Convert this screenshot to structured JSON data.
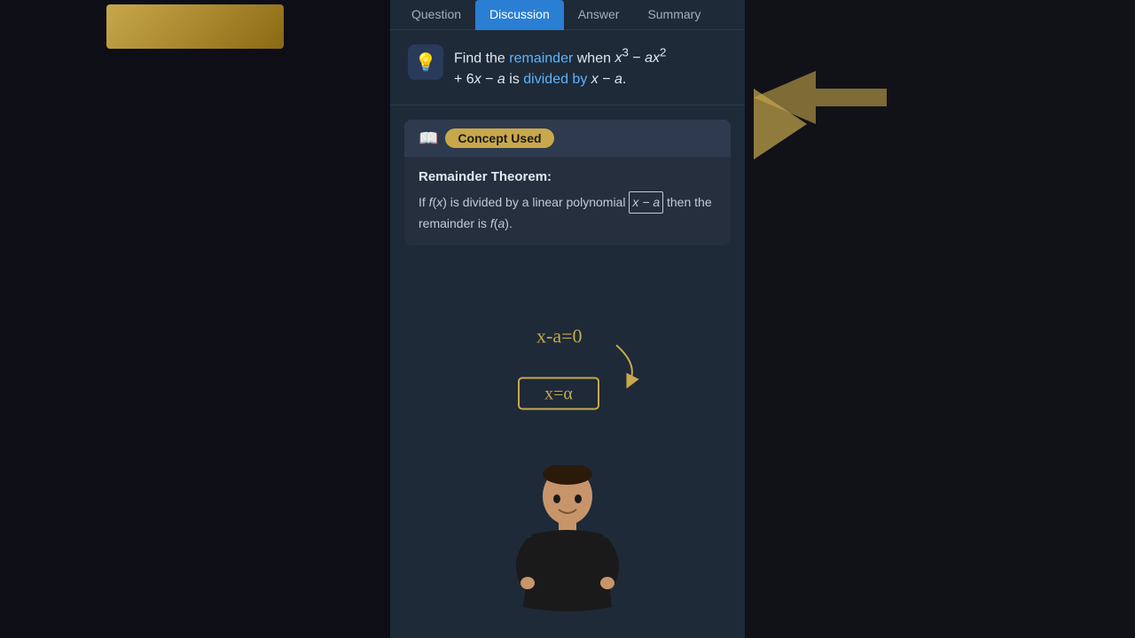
{
  "tabs": [
    {
      "id": "question",
      "label": "Question",
      "active": false
    },
    {
      "id": "discussion",
      "label": "Discussion",
      "active": true
    },
    {
      "id": "answer",
      "label": "Answer",
      "active": false
    },
    {
      "id": "summary",
      "label": "Summary",
      "active": false
    }
  ],
  "question": {
    "text_prefix": "Find the ",
    "highlight1": "remainder",
    "text_middle": " when ",
    "math_expr": "x³ − ax²",
    "text_line2": "+ 6x − a is ",
    "highlight2": "divided by",
    "text_end": " x − a."
  },
  "concept": {
    "header_label": "Concept Used",
    "theorem_title": "Remainder Theorem:",
    "theorem_text_prefix": "If ",
    "theorem_fx": "f(x)",
    "theorem_text_mid": " is divided by a linear polynomial ",
    "theorem_box_text": "x − a",
    "theorem_text_end": " then the remainder is ",
    "theorem_fa": "f(a)",
    "theorem_period": "."
  },
  "drawing": {
    "equation1": "x-a=0",
    "equation2": "x=α",
    "arrow_note": "annotation arrow pointing to x-a in theorem"
  },
  "colors": {
    "accent_blue": "#5ab4ff",
    "accent_yellow": "#c8a84b",
    "tab_active_bg": "#2a7fd4",
    "panel_bg": "#1e2a38",
    "concept_bg": "#252f3e"
  }
}
